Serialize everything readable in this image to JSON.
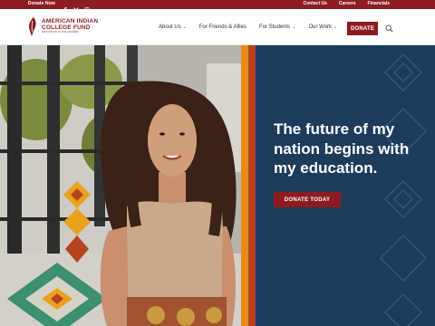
{
  "topbar": {
    "donate_now": "Donate Now",
    "social": [
      {
        "icon": "facebook-icon",
        "glyph": "f"
      },
      {
        "icon": "x-twitter-icon",
        "glyph": "𝕏"
      },
      {
        "icon": "instagram-icon",
        "glyph": "◎"
      }
    ],
    "links": [
      "Contact Us",
      "Careers",
      "Financials"
    ]
  },
  "header": {
    "logo": {
      "line1": "AMERICAN INDIAN",
      "line2": "COLLEGE FUND",
      "tagline": "EDUCATION IS THE ANSWER"
    },
    "nav": [
      {
        "label": "About Us",
        "has_dropdown": true
      },
      {
        "label": "For Friends & Allies",
        "has_dropdown": false
      },
      {
        "label": "For Students",
        "has_dropdown": true
      },
      {
        "label": "Our Work",
        "has_dropdown": true
      }
    ],
    "donate_label": "DONATE",
    "search_icon": "search-icon"
  },
  "hero": {
    "headline": "The future of my nation begins with my education.",
    "cta_label": "DONATE TODAY"
  },
  "colors": {
    "brand_red": "#8d1c22",
    "navy": "#1d3c5c",
    "orange": "#e88a1a",
    "rust": "#b5431f"
  }
}
